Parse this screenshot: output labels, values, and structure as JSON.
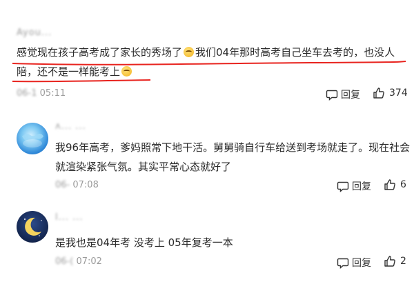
{
  "comments": [
    {
      "username": "Ayou...",
      "text_line1": "感觉现在孩子高考成了家长的秀场了",
      "text_line1b": "我们04年那时高考自己坐车去考的，也没人",
      "text_line2": "陪，还不是一样能考上",
      "date": "06-1",
      "time": "05:11",
      "reply_label": "回复",
      "like_count": "374"
    },
    {
      "username": "ʌ... ...",
      "text_line1": "我96年高考，爹妈照常下地干活。舅舅骑自行车给送到考场就走了。现在社会",
      "text_line2": "就渲染紧张气氛。其实平常心态就好了",
      "date": "06-",
      "time": "07:08",
      "reply_label": "回复",
      "like_count": "6"
    },
    {
      "username": "l...  ...",
      "text_line1": "是我也是04年考 没考上 05年复考一本",
      "date": "06-(",
      "time": "07:02",
      "reply_label": "回复",
      "like_count": "2"
    }
  ],
  "colors": {
    "underline": "#e8231e",
    "meta": "#9b9b9b",
    "text": "#2a2a2a"
  }
}
